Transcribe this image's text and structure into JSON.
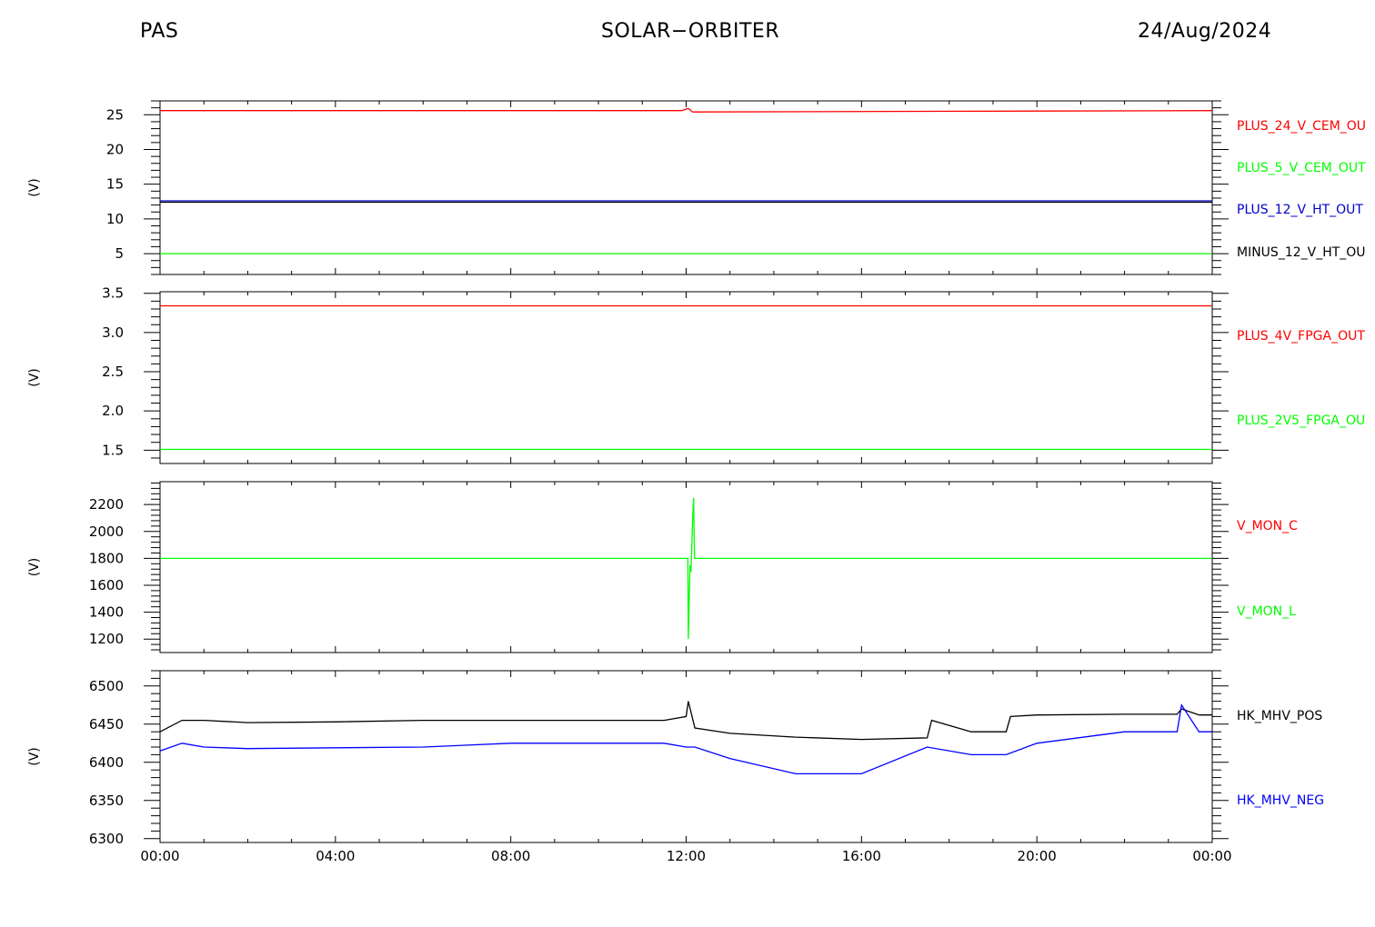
{
  "header": {
    "left": "PAS",
    "center": "SOLAR−ORBITER",
    "right": "24/Aug/2024"
  },
  "chart_data": [
    {
      "type": "line",
      "ylabel": "(V)",
      "ylim": [
        2.0,
        27.0
      ],
      "yticks": [
        5,
        10,
        15,
        20,
        25
      ],
      "ytick_labels": [
        "5",
        "10",
        "15",
        "20",
        "25"
      ],
      "x_hours_range": [
        0,
        24
      ],
      "series": [
        {
          "name": "PLUS_24_V_CEM_OU",
          "color": "#ff0000",
          "x_hours": [
            0,
            1.5,
            11.9,
            12.05,
            12.15,
            24
          ],
          "values": [
            25.6,
            25.6,
            25.6,
            25.9,
            25.4,
            25.6
          ]
        },
        {
          "name": "PLUS_5_V_CEM_OUT",
          "color": "#00ff00",
          "x_hours": [
            0,
            24
          ],
          "values": [
            5.0,
            5.0
          ]
        },
        {
          "name": "PLUS_12_V_HT_OUT",
          "color": "#0000cc",
          "x_hours": [
            0,
            24
          ],
          "values": [
            12.6,
            12.6
          ]
        },
        {
          "name": "MINUS_12_V_HT_OU",
          "color": "#000000",
          "x_hours": [
            0,
            24
          ],
          "values": [
            12.4,
            12.4
          ]
        }
      ]
    },
    {
      "type": "line",
      "ylabel": "(V)",
      "ylim": [
        1.33,
        3.52
      ],
      "yticks": [
        1.5,
        2.0,
        2.5,
        3.0,
        3.5
      ],
      "ytick_labels": [
        "1.5",
        "2.0",
        "2.5",
        "3.0",
        "3.5"
      ],
      "x_hours_range": [
        0,
        24
      ],
      "series": [
        {
          "name": "PLUS_4V_FPGA_OUT",
          "color": "#ff0000",
          "x_hours": [
            0,
            24
          ],
          "values": [
            3.34,
            3.34
          ]
        },
        {
          "name": "PLUS_2V5_FPGA_OU",
          "color": "#00ff00",
          "x_hours": [
            0,
            24
          ],
          "values": [
            1.51,
            1.51
          ]
        }
      ]
    },
    {
      "type": "line",
      "ylabel": "(V)",
      "ylim": [
        1100,
        2370
      ],
      "yticks": [
        1200,
        1400,
        1600,
        1800,
        2000,
        2200
      ],
      "ytick_labels": [
        "1200",
        "1400",
        "1600",
        "1800",
        "2000",
        "2200"
      ],
      "x_hours_range": [
        0,
        24
      ],
      "series": [
        {
          "name": "V_MON_C",
          "color": "#ff0000",
          "x_hours": [],
          "values": []
        },
        {
          "name": "V_MON_L",
          "color": "#00ff00",
          "x_hours": [
            0,
            12.04,
            12.05,
            12.07,
            12.09,
            12.11,
            12.13,
            12.15,
            12.17,
            12.19,
            24
          ],
          "values": [
            1800,
            1800,
            1200,
            1500,
            1750,
            1700,
            1900,
            2100,
            2250,
            1800,
            1800
          ]
        }
      ]
    },
    {
      "type": "line",
      "ylabel": "(V)",
      "ylim": [
        6295,
        6520
      ],
      "yticks": [
        6300,
        6350,
        6400,
        6450,
        6500
      ],
      "ytick_labels": [
        "6300",
        "6350",
        "6400",
        "6450",
        "6500"
      ],
      "xticks": [
        "00:00",
        "04:00",
        "08:00",
        "12:00",
        "16:00",
        "20:00",
        "00:00"
      ],
      "x_hours_range": [
        0,
        24
      ],
      "series": [
        {
          "name": "HK_MHV_POS",
          "color": "#000000",
          "x_hours": [
            0,
            0.5,
            1.0,
            2.0,
            4.0,
            6.0,
            8.0,
            10.0,
            11.5,
            12.0,
            12.05,
            12.2,
            13.0,
            14.5,
            16.0,
            17.5,
            17.6,
            18.5,
            19.3,
            19.4,
            20.0,
            22.0,
            23.2,
            23.3,
            23.7,
            24
          ],
          "values": [
            6440,
            6455,
            6455,
            6452,
            6453,
            6455,
            6455,
            6455,
            6455,
            6460,
            6480,
            6445,
            6438,
            6433,
            6430,
            6432,
            6455,
            6440,
            6440,
            6460,
            6462,
            6463,
            6463,
            6470,
            6462,
            6462
          ]
        },
        {
          "name": "HK_MHV_NEG",
          "color": "#0000ff",
          "x_hours": [
            0,
            0.5,
            1.0,
            2.0,
            4.0,
            6.0,
            8.0,
            10.0,
            11.5,
            12.0,
            12.2,
            13.0,
            14.5,
            16.0,
            17.5,
            18.5,
            19.3,
            20.0,
            22.0,
            23.2,
            23.3,
            23.7,
            24
          ],
          "values": [
            6415,
            6425,
            6420,
            6418,
            6419,
            6420,
            6425,
            6425,
            6425,
            6420,
            6420,
            6405,
            6385,
            6385,
            6420,
            6410,
            6410,
            6425,
            6440,
            6440,
            6475,
            6440,
            6440
          ]
        }
      ]
    }
  ]
}
